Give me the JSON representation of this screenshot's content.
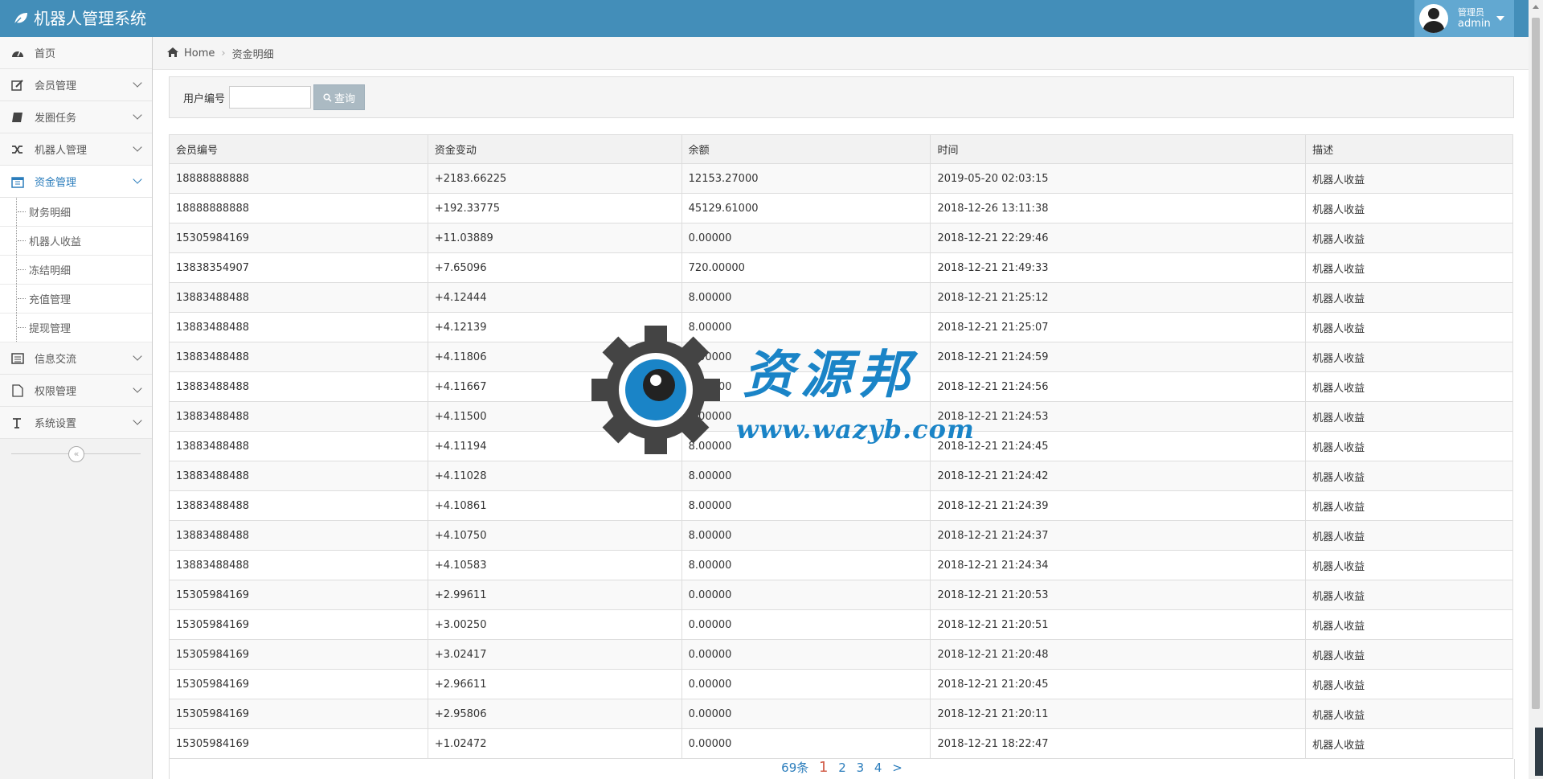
{
  "header": {
    "brand": "机器人管理系统",
    "user_role": "管理员",
    "user_name": "admin",
    "bg_color": "#438eb9"
  },
  "sidebar": {
    "items": [
      {
        "label": "首页",
        "icon": "dashboard-icon"
      },
      {
        "label": "会员管理",
        "icon": "edit-icon"
      },
      {
        "label": "发圈任务",
        "icon": "book-icon"
      },
      {
        "label": "机器人管理",
        "icon": "random-icon"
      },
      {
        "label": "资金管理",
        "icon": "calendar-icon",
        "active": true
      },
      {
        "label": "信息交流",
        "icon": "list-icon"
      },
      {
        "label": "权限管理",
        "icon": "file-icon"
      },
      {
        "label": "系统设置",
        "icon": "text-icon"
      }
    ],
    "sub_items": [
      "财务明细",
      "机器人收益",
      "冻结明细",
      "充值管理",
      "提现管理"
    ],
    "collapse_glyph": "«"
  },
  "breadcrumb": {
    "home": "Home",
    "current": "资金明细"
  },
  "search": {
    "label": "用户编号",
    "value": "",
    "button": "查询"
  },
  "table": {
    "columns": [
      "会员编号",
      "资金变动",
      "余额",
      "时间",
      "描述"
    ],
    "rows": [
      [
        "18888888888",
        "+2183.66225",
        "12153.27000",
        "2019-05-20 02:03:15",
        "机器人收益"
      ],
      [
        "18888888888",
        "+192.33775",
        "45129.61000",
        "2018-12-26 13:11:38",
        "机器人收益"
      ],
      [
        "15305984169",
        "+11.03889",
        "0.00000",
        "2018-12-21 22:29:46",
        "机器人收益"
      ],
      [
        "13838354907",
        "+7.65096",
        "720.00000",
        "2018-12-21 21:49:33",
        "机器人收益"
      ],
      [
        "13883488488",
        "+4.12444",
        "8.00000",
        "2018-12-21 21:25:12",
        "机器人收益"
      ],
      [
        "13883488488",
        "+4.12139",
        "8.00000",
        "2018-12-21 21:25:07",
        "机器人收益"
      ],
      [
        "13883488488",
        "+4.11806",
        "8.00000",
        "2018-12-21 21:24:59",
        "机器人收益"
      ],
      [
        "13883488488",
        "+4.11667",
        "8.00000",
        "2018-12-21 21:24:56",
        "机器人收益"
      ],
      [
        "13883488488",
        "+4.11500",
        "8.00000",
        "2018-12-21 21:24:53",
        "机器人收益"
      ],
      [
        "13883488488",
        "+4.11194",
        "8.00000",
        "2018-12-21 21:24:45",
        "机器人收益"
      ],
      [
        "13883488488",
        "+4.11028",
        "8.00000",
        "2018-12-21 21:24:42",
        "机器人收益"
      ],
      [
        "13883488488",
        "+4.10861",
        "8.00000",
        "2018-12-21 21:24:39",
        "机器人收益"
      ],
      [
        "13883488488",
        "+4.10750",
        "8.00000",
        "2018-12-21 21:24:37",
        "机器人收益"
      ],
      [
        "13883488488",
        "+4.10583",
        "8.00000",
        "2018-12-21 21:24:34",
        "机器人收益"
      ],
      [
        "15305984169",
        "+2.99611",
        "0.00000",
        "2018-12-21 21:20:53",
        "机器人收益"
      ],
      [
        "15305984169",
        "+3.00250",
        "0.00000",
        "2018-12-21 21:20:51",
        "机器人收益"
      ],
      [
        "15305984169",
        "+3.02417",
        "0.00000",
        "2018-12-21 21:20:48",
        "机器人收益"
      ],
      [
        "15305984169",
        "+2.96611",
        "0.00000",
        "2018-12-21 21:20:45",
        "机器人收益"
      ],
      [
        "15305984169",
        "+2.95806",
        "0.00000",
        "2018-12-21 21:20:11",
        "机器人收益"
      ],
      [
        "15305984169",
        "+1.02472",
        "0.00000",
        "2018-12-21 18:22:47",
        "机器人收益"
      ]
    ]
  },
  "pagination": {
    "total": "69条",
    "pages": [
      "1",
      "2",
      "3",
      "4"
    ],
    "current": "1",
    "next": ">"
  },
  "watermark": {
    "title": "资源邦",
    "url": "www.wazyb.com"
  }
}
